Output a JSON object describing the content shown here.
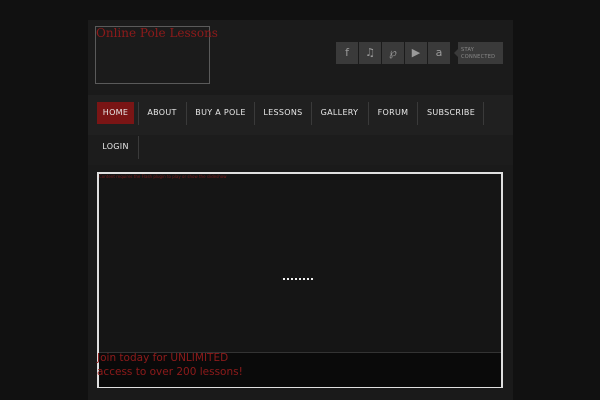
{
  "site": {
    "logo_text": "Online Pole Lessons"
  },
  "social": {
    "icons": [
      {
        "name": "facebook-icon",
        "glyph": "f"
      },
      {
        "name": "twitter-icon",
        "glyph": "♫"
      },
      {
        "name": "pinterest-icon",
        "glyph": "℘"
      },
      {
        "name": "youtube-icon",
        "glyph": "▶"
      },
      {
        "name": "amazon-icon",
        "glyph": "a"
      }
    ],
    "stay_line1": "STAY",
    "stay_line2": "CONNECTED"
  },
  "nav": {
    "items": [
      {
        "label": "HOME",
        "active": true
      },
      {
        "label": "ABOUT"
      },
      {
        "label": "BUY A POLE"
      },
      {
        "label": "LESSONS"
      },
      {
        "label": "GALLERY"
      },
      {
        "label": "FORUM"
      },
      {
        "label": "SUBSCRIBE"
      },
      {
        "label": "LOGIN"
      }
    ]
  },
  "slider": {
    "top_text": "Content requires the Flash plugin to play or show the slideshow",
    "caption_line1": "Join today for UNLIMITED",
    "caption_line2": "access to over 200 lessons!"
  },
  "colors": {
    "accent": "#7a1515",
    "brand_text": "#8e1b1b",
    "background": "#111111"
  }
}
